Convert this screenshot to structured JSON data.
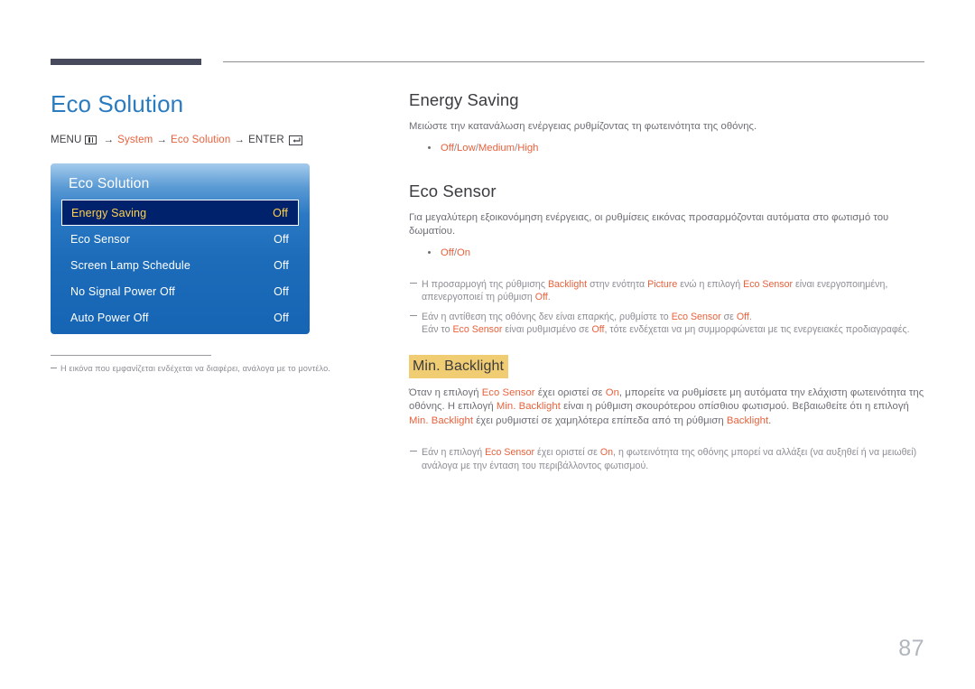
{
  "header": {
    "rule_dark_color": "#474a5c",
    "rule_light_color": "#8d8d92"
  },
  "left": {
    "page_title": "Eco Solution",
    "menu_path": {
      "menu_label": "MENU",
      "menu_icon": "menu-grid-icon",
      "arrow1": "→",
      "item1": "System",
      "arrow2": "→",
      "item2": "Eco Solution",
      "arrow3": "→",
      "enter_label": "ENTER",
      "enter_icon": "enter-return-icon"
    },
    "osd": {
      "title": "Eco Solution",
      "rows": [
        {
          "label": "Energy Saving",
          "value": "Off",
          "selected": true
        },
        {
          "label": "Eco Sensor",
          "value": "Off",
          "selected": false
        },
        {
          "label": "Screen Lamp Schedule",
          "value": "Off",
          "selected": false
        },
        {
          "label": "No Signal Power Off",
          "value": "Off",
          "selected": false
        },
        {
          "label": "Auto Power Off",
          "value": "Off",
          "selected": false
        }
      ],
      "selected_text_color": "#ffd24d",
      "selected_bg_color": "#00216b"
    },
    "footnote": "Η εικόνα που εμφανίζεται ενδέχεται να διαφέρει, ανάλογα με το μοντέλο."
  },
  "right": {
    "energy_saving": {
      "heading": "Energy Saving",
      "paragraph": "Μειώστε την κατανάλωση ενέργειας ρυθμίζοντας τη φωτεινότητα της οθόνης.",
      "option_off": "Off",
      "option_low": "Low",
      "option_medium": "Medium",
      "option_high": "High",
      "sep": "/"
    },
    "eco_sensor": {
      "heading": "Eco Sensor",
      "paragraph": "Για μεγαλύτερη εξοικονόμηση ενέργειας, οι ρυθμίσεις εικόνας προσαρμόζονται αυτόματα στο φωτισμό του δωματίου.",
      "option_off": "Off",
      "option_on": "On",
      "sep": "/",
      "note1_a": "Η προσαρμογή της ρύθμισης ",
      "note1_b": "Backlight",
      "note1_c": " στην ενότητα ",
      "note1_d": "Picture",
      "note1_e": " ενώ η επιλογή ",
      "note1_f": "Eco Sensor",
      "note1_g": " είναι ενεργοποιημένη, απενεργοποιεί τη ρύθμιση ",
      "note1_h": "Off",
      "note1_i": ".",
      "note2_a": "Εάν η αντίθεση της οθόνης δεν είναι επαρκής, ρυθμίστε το ",
      "note2_b": "Eco Sensor",
      "note2_c": " σε ",
      "note2_d": "Off",
      "note2_e": ".",
      "note2_f": "Εάν το ",
      "note2_g": "Eco Sensor",
      "note2_h": " είναι ρυθμισμένο σε ",
      "note2_i": "Off",
      "note2_j": ", τότε ενδέχεται να μη συμμορφώνεται με τις ενεργειακές προδιαγραφές."
    },
    "min_backlight": {
      "heading": "Min. Backlight",
      "highlight_color": "#f0cd72",
      "p_a": "Όταν η επιλογή ",
      "p_b": "Eco Sensor",
      "p_c": " έχει οριστεί σε ",
      "p_d": "On",
      "p_e": ", μπορείτε να ρυθμίσετε μη αυτόματα την ελάχιστη φωτεινότητα της οθόνης. Η επιλογή ",
      "p_f": "Min. Backlight",
      "p_g": " είναι η ρύθμιση σκουρότερου οπίσθιου φωτισμού. Βεβαιωθείτε ότι η επιλογή ",
      "p_h": "Min. Backlight",
      "p_i": " έχει ρυθμιστεί σε χαμηλότερα επίπεδα από τη ρύθμιση ",
      "p_j": "Backlight",
      "p_k": ".",
      "note_a": "Εάν η επιλογή ",
      "note_b": "Eco Sensor",
      "note_c": " έχει οριστεί σε ",
      "note_d": "On",
      "note_e": ", η φωτεινότητα της οθόνης μπορεί να αλλάξει (να αυξηθεί ή να μειωθεί) ανάλογα με την ένταση του περιβάλλοντος φωτισμού."
    }
  },
  "page_number": "87"
}
